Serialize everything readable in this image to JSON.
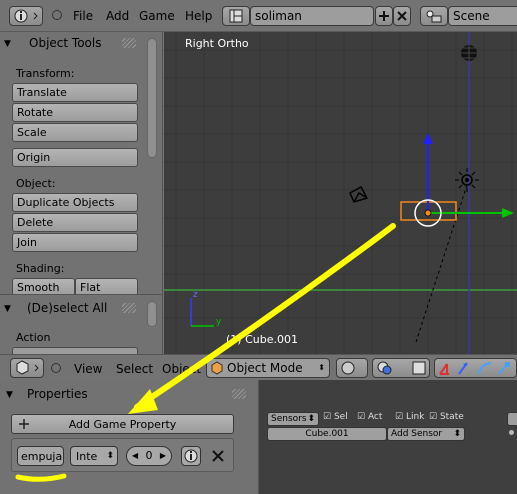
{
  "topbar": {
    "menu": [
      "File",
      "Add",
      "Game",
      "Help"
    ],
    "screen_name": "soliman",
    "scene_name": "Scene"
  },
  "tool_shelf": {
    "title": "Object Tools",
    "transform_label": "Transform:",
    "transform_buttons": [
      "Translate",
      "Rotate",
      "Scale"
    ],
    "origin_button": "Origin",
    "object_label": "Object:",
    "object_buttons": [
      "Duplicate Objects",
      "Delete",
      "Join"
    ],
    "shading_label": "Shading:",
    "shading_buttons": [
      "Smooth",
      "Flat"
    ]
  },
  "redo_panel": {
    "title": "(De)select All",
    "action_label": "Action"
  },
  "viewport": {
    "title": "Right Ortho",
    "object_name": "(1) Cube.001",
    "axis_y_label": "y",
    "axis_z_label": "z"
  },
  "view3d_header": {
    "menu": [
      "View",
      "Select",
      "Object"
    ],
    "mode": "Object Mode"
  },
  "logic": {
    "properties_title": "Properties",
    "add_property_label": "Add Game Property",
    "property": {
      "name": "empuja",
      "type": "Inte",
      "value": "0"
    },
    "sensors": {
      "dropdown": "Sensors",
      "sel": "Sel",
      "act": "Act",
      "link": "Link",
      "state": "State",
      "object": "Cube.001",
      "add_sensor": "Add Sensor"
    }
  },
  "colors": {
    "annotation": "#ffff00",
    "selection": "#f18a1e",
    "axis_x": "#00c000",
    "axis_z": "#3030ff",
    "viewport_bg": "#3d3d3d"
  }
}
